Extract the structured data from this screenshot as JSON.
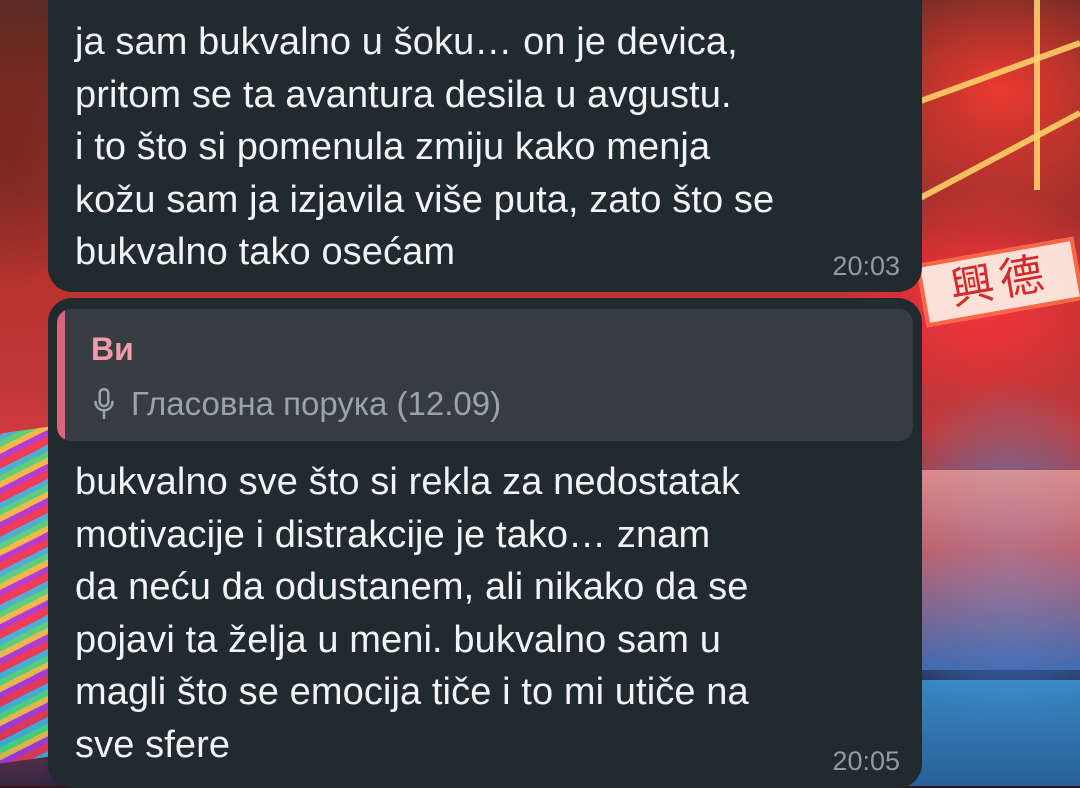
{
  "messages": [
    {
      "text": "ja sam bukvalno u šoku… on je devica,\npritom se ta avantura desila u avgustu.\ni to što si pomenula zmiju kako menja\nkožu sam ja izjavila više puta, zato što se\nbukvalno tako osećam",
      "time": "20:03"
    },
    {
      "reply": {
        "author": "Ви",
        "icon": "microphone-icon",
        "label": "Гласовна порука (12.09)"
      },
      "text": "bukvalno sve što si rekla za nedostatak\nmotivacije i distrakcije je tako… znam\nda neću da odustanem, ali nikako da se\npojavi ta želja u meni. bukvalno sam u\nmagli što se emocija tiče i to mi utiče na\nsve sfere",
      "time": "20:05"
    }
  ],
  "colors": {
    "bubble_bg": "#212a2f",
    "reply_bg": "#363d41",
    "reply_accent": "#d9657a",
    "reply_author": "#f49aab",
    "text": "#f1f3f4",
    "timestamp": "#8f9ba1"
  }
}
